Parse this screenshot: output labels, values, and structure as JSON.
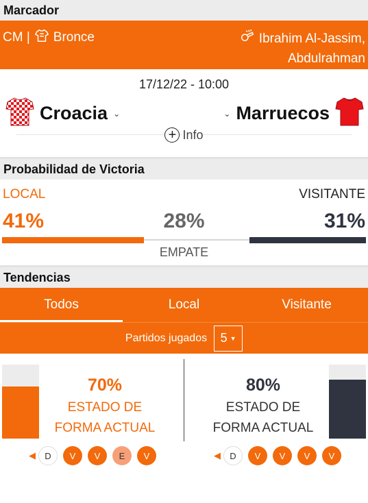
{
  "marcador": {
    "title": "Marcador",
    "competition": "CM |",
    "round": "Bronce",
    "referee_line1": "Ibrahim Al-Jassim,",
    "referee_line2": "Abdulrahman"
  },
  "match": {
    "datetime": "17/12/22 - 10:00",
    "home_team": "Croacia",
    "away_team": "Marruecos",
    "info_label": "Info"
  },
  "probability": {
    "title": "Probabilidad de Victoria",
    "home_label": "LOCAL",
    "away_label": "VISITANTE",
    "home_pct": "41%",
    "draw_pct": "28%",
    "away_pct": "31%",
    "draw_label": "EMPATE",
    "home_fraction": 0.41,
    "draw_fraction": 0.28,
    "away_fraction": 0.31
  },
  "trends": {
    "title": "Tendencias",
    "tabs": [
      "Todos",
      "Local",
      "Visitante"
    ],
    "active_tab": "Todos",
    "played_label": "Partidos jugados",
    "played_value": "5",
    "home": {
      "pct": "70%",
      "fraction": 0.7,
      "label_line1": "ESTADO DE",
      "label_line2": "FORMA ACTUAL",
      "results": [
        "D",
        "V",
        "V",
        "E",
        "V"
      ]
    },
    "away": {
      "pct": "80%",
      "fraction": 0.8,
      "label_line1": "ESTADO DE",
      "label_line2": "FORMA ACTUAL",
      "results": [
        "D",
        "V",
        "V",
        "V",
        "V"
      ]
    }
  },
  "colors": {
    "accent": "#f26a0b",
    "away_dark": "#2f3440",
    "draw_result": "#f7a077"
  }
}
